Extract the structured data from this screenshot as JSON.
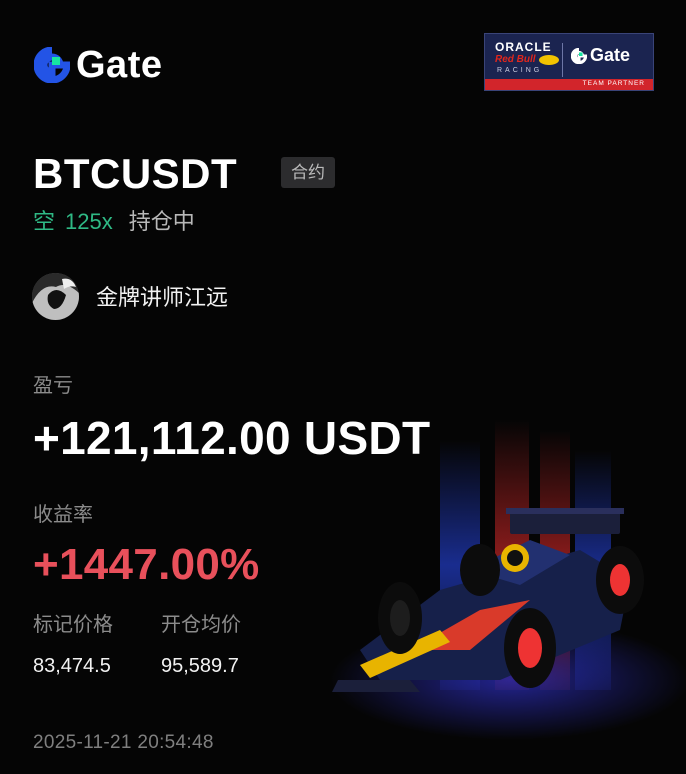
{
  "brand": {
    "name": "Gate",
    "accent": "#2354e6",
    "accent2": "#17e6a1"
  },
  "partner_badge": {
    "oracle": "ORACLE",
    "red_bull": "Red Bull",
    "racing": "RACING",
    "gate": "Gate",
    "team_partner": "TEAM PARTNER"
  },
  "position": {
    "pair": "BTCUSDT",
    "type_tag": "合约",
    "direction": "空",
    "leverage": "125x",
    "status": "持仓中"
  },
  "author": {
    "name": "金牌讲师江远"
  },
  "pnl": {
    "label": "盈亏",
    "value": "+121,112.00 USDT",
    "color": "#ffffff"
  },
  "roi": {
    "label": "收益率",
    "value": "+1447.00%",
    "color": "#e8505b"
  },
  "prices": {
    "mark_label": "标记价格",
    "mark_value": "83,474.5",
    "entry_label": "开仓均价",
    "entry_value": "95,589.7"
  },
  "timestamp": "2025-11-21 20:54:48",
  "colors": {
    "positive_green": "#2fb985",
    "loss_red": "#e8505b",
    "background": "#050505"
  }
}
